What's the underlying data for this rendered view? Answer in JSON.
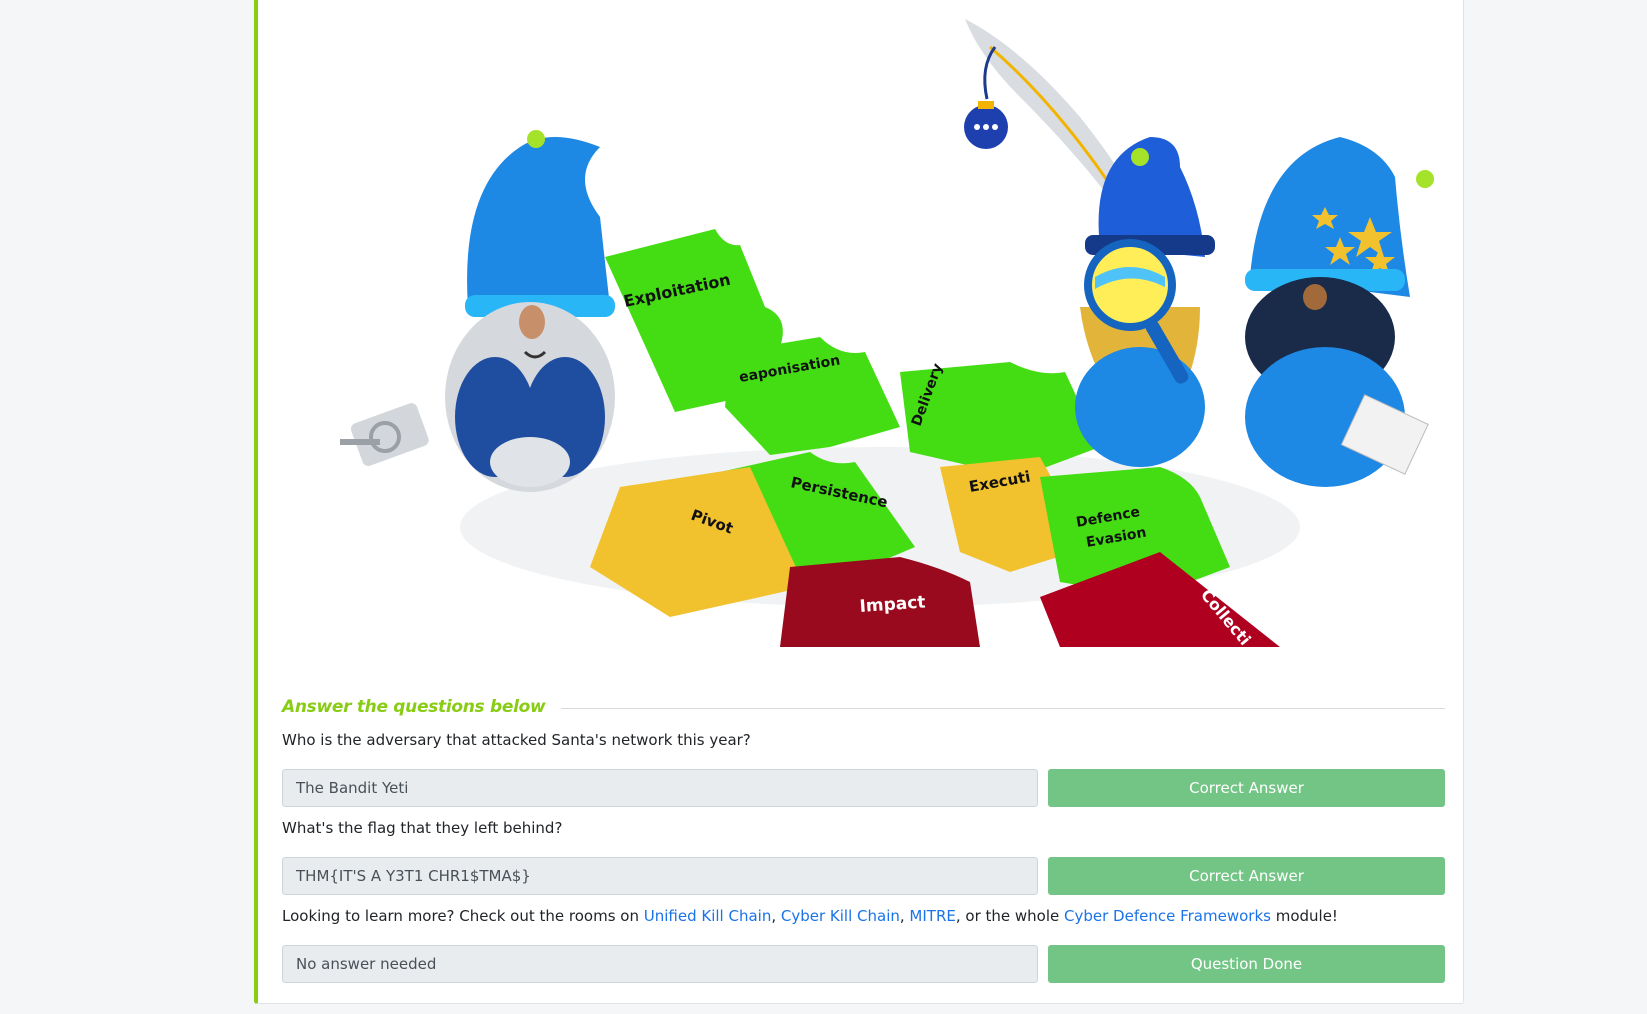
{
  "task": {
    "answer_section_title": "Answer the questions below",
    "questions": [
      {
        "text": "Who is the adversary that attacked Santa's network this year?",
        "answer": "The Bandit Yeti",
        "button": "Correct Answer"
      },
      {
        "text": "What's the flag that they left behind?",
        "answer": "THM{IT'S A Y3T1 CHR1$TMA$}",
        "button": "Correct Answer"
      },
      {
        "text_prefix": "Looking to learn more? Check out the rooms on ",
        "links": [
          "Unified Kill Chain",
          "Cyber Kill Chain",
          "MITRE",
          "Cyber Defence Frameworks"
        ],
        "sep1": ", ",
        "sep2": ", ",
        "sep3": ", or the whole ",
        "text_suffix": " module!",
        "answer": "No answer needed",
        "button": "Question Done"
      }
    ]
  },
  "illustration": {
    "puzzle_labels": [
      "Exploitation",
      "Weaponisation",
      "Delivery",
      "Persistence",
      "Execution",
      "Pivoting",
      "Defence",
      "Evasion",
      "Impact",
      "Collection"
    ],
    "icons": [
      "gnome-icon",
      "feather-quill-icon",
      "ornament-icon",
      "magnifying-glass-icon",
      "keys-icon",
      "paper-stack-icon"
    ]
  },
  "colors": {
    "accent": "#88cc14",
    "button_success": "#72c585",
    "link": "#1a73e8",
    "puzzle_green": "#44dd14",
    "puzzle_yellow": "#f2c12e",
    "puzzle_red": "#b00020",
    "gnome_blue": "#1e88e5"
  }
}
